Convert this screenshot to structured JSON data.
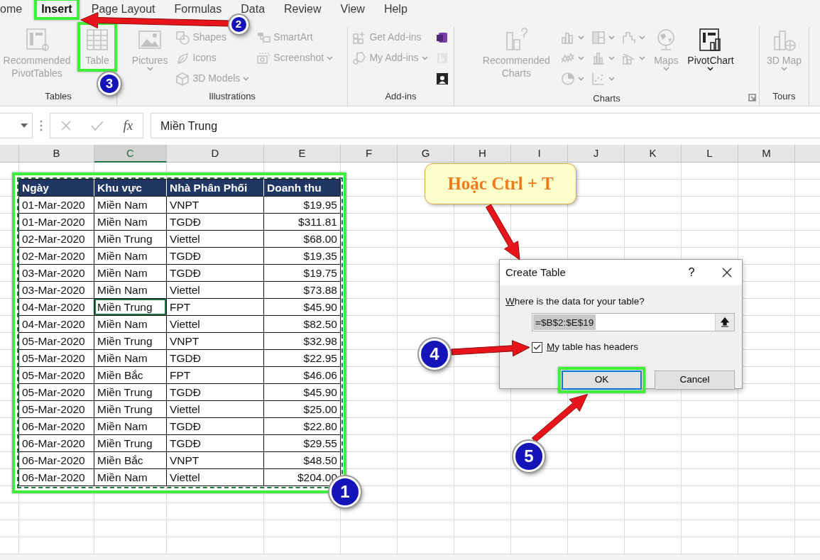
{
  "ribbon_tabs": [
    {
      "label": "ome",
      "selected": false
    },
    {
      "label": "Insert",
      "selected": true
    },
    {
      "label": "Page Layout",
      "selected": false
    },
    {
      "label": "Formulas",
      "selected": false
    },
    {
      "label": "Data",
      "selected": false
    },
    {
      "label": "Review",
      "selected": false
    },
    {
      "label": "View",
      "selected": false
    },
    {
      "label": "Help",
      "selected": false
    }
  ],
  "ribbon_groups": [
    {
      "label": "Tables",
      "items": [
        {
          "kind": "large",
          "label": "Recommended PivotTables",
          "disabled": true
        },
        {
          "kind": "large",
          "label": "Table",
          "disabled": true
        }
      ]
    },
    {
      "label": "Illustrations",
      "items": [
        {
          "kind": "large",
          "label": "Pictures",
          "disabled": true,
          "dropdown": true
        },
        {
          "kind": "small",
          "label": "Shapes",
          "disabled": true
        },
        {
          "kind": "small",
          "label": "Icons",
          "disabled": true
        },
        {
          "kind": "small",
          "label": "3D Models",
          "disabled": true,
          "dropdown": true
        },
        {
          "kind": "small",
          "label": "SmartArt",
          "disabled": true
        },
        {
          "kind": "small",
          "label": "Screenshot",
          "disabled": true,
          "dropdown": true
        }
      ]
    },
    {
      "label": "Add-ins",
      "items": [
        {
          "kind": "small",
          "label": "Get Add-ins",
          "disabled": true
        },
        {
          "kind": "small",
          "label": "My Add-ins",
          "disabled": true,
          "dropdown": true
        },
        {
          "kind": "icon",
          "disabled": false
        },
        {
          "kind": "icon",
          "disabled": true
        },
        {
          "kind": "icon",
          "disabled": false
        }
      ]
    },
    {
      "label": "Charts",
      "items": [
        {
          "kind": "large",
          "label": "Recommended Charts",
          "disabled": true
        },
        {
          "kind": "icon",
          "disabled": true,
          "dropdown": true
        },
        {
          "kind": "icon",
          "disabled": true,
          "dropdown": true
        },
        {
          "kind": "icon",
          "disabled": true,
          "dropdown": true
        },
        {
          "kind": "icon",
          "disabled": true,
          "dropdown": true
        },
        {
          "kind": "icon",
          "disabled": true,
          "dropdown": true
        },
        {
          "kind": "icon",
          "disabled": true,
          "dropdown": true
        },
        {
          "kind": "icon",
          "disabled": true,
          "dropdown": true
        },
        {
          "kind": "icon",
          "disabled": true,
          "dropdown": true
        },
        {
          "kind": "large",
          "label": "Maps",
          "disabled": true,
          "dropdown": true
        },
        {
          "kind": "large",
          "label": "PivotChart",
          "disabled": false,
          "dropdown": true
        }
      ]
    },
    {
      "label": "Tours",
      "items": [
        {
          "kind": "large",
          "label": "3D Map",
          "disabled": true,
          "dropdown": true
        }
      ]
    }
  ],
  "formula_bar": {
    "fx_label": "fx",
    "value": "Miền Trung"
  },
  "columns": [
    {
      "label": "B",
      "selected": false
    },
    {
      "label": "C",
      "selected": true
    },
    {
      "label": "D",
      "selected": false
    },
    {
      "label": "E",
      "selected": false
    },
    {
      "label": "F",
      "selected": false
    },
    {
      "label": "G",
      "selected": false
    },
    {
      "label": "H",
      "selected": false
    },
    {
      "label": "I",
      "selected": false
    },
    {
      "label": "J",
      "selected": false
    },
    {
      "label": "K",
      "selected": false
    },
    {
      "label": "L",
      "selected": false
    },
    {
      "label": "M",
      "selected": false
    }
  ],
  "data_table": {
    "headers": [
      "Ngày",
      "Khu vực",
      "Nhà Phân Phối",
      "Doanh thu"
    ],
    "rows": [
      {
        "cells": [
          {
            "text": "01-Mar-2020",
            "selected": false
          },
          {
            "text": "Miền Nam",
            "selected": false
          },
          {
            "text": "VNPT",
            "selected": false
          },
          {
            "text": "$19.95",
            "selected": false
          }
        ]
      },
      {
        "cells": [
          {
            "text": "01-Mar-2020",
            "selected": false
          },
          {
            "text": "Miền Nam",
            "selected": false
          },
          {
            "text": "TGDĐ",
            "selected": false
          },
          {
            "text": "$311.81",
            "selected": false
          }
        ]
      },
      {
        "cells": [
          {
            "text": "02-Mar-2020",
            "selected": false
          },
          {
            "text": "Miền Trung",
            "selected": false
          },
          {
            "text": "Viettel",
            "selected": false
          },
          {
            "text": "$68.00",
            "selected": false
          }
        ]
      },
      {
        "cells": [
          {
            "text": "02-Mar-2020",
            "selected": false
          },
          {
            "text": "Miền Nam",
            "selected": false
          },
          {
            "text": "TGDĐ",
            "selected": false
          },
          {
            "text": "$19.35",
            "selected": false
          }
        ]
      },
      {
        "cells": [
          {
            "text": "03-Mar-2020",
            "selected": false
          },
          {
            "text": "Miền Nam",
            "selected": false
          },
          {
            "text": "TGDĐ",
            "selected": false
          },
          {
            "text": "$19.75",
            "selected": false
          }
        ]
      },
      {
        "cells": [
          {
            "text": "03-Mar-2020",
            "selected": false
          },
          {
            "text": "Miền Nam",
            "selected": false
          },
          {
            "text": "Viettel",
            "selected": false
          },
          {
            "text": "$73.88",
            "selected": false
          }
        ]
      },
      {
        "cells": [
          {
            "text": "04-Mar-2020",
            "selected": false
          },
          {
            "text": "Miền Trung",
            "selected": true
          },
          {
            "text": "FPT",
            "selected": false
          },
          {
            "text": "$45.90",
            "selected": false
          }
        ]
      },
      {
        "cells": [
          {
            "text": "04-Mar-2020",
            "selected": false
          },
          {
            "text": "Miền Nam",
            "selected": false
          },
          {
            "text": "Viettel",
            "selected": false
          },
          {
            "text": "$82.50",
            "selected": false
          }
        ]
      },
      {
        "cells": [
          {
            "text": "05-Mar-2020",
            "selected": false
          },
          {
            "text": "Miền Trung",
            "selected": false
          },
          {
            "text": "VNPT",
            "selected": false
          },
          {
            "text": "$32.98",
            "selected": false
          }
        ]
      },
      {
        "cells": [
          {
            "text": "05-Mar-2020",
            "selected": false
          },
          {
            "text": "Miền Nam",
            "selected": false
          },
          {
            "text": "TGDĐ",
            "selected": false
          },
          {
            "text": "$22.95",
            "selected": false
          }
        ]
      },
      {
        "cells": [
          {
            "text": "05-Mar-2020",
            "selected": false
          },
          {
            "text": "Miền Bắc",
            "selected": false
          },
          {
            "text": "FPT",
            "selected": false
          },
          {
            "text": "$46.06",
            "selected": false
          }
        ]
      },
      {
        "cells": [
          {
            "text": "05-Mar-2020",
            "selected": false
          },
          {
            "text": "Miền Trung",
            "selected": false
          },
          {
            "text": "TGDĐ",
            "selected": false
          },
          {
            "text": "$45.90",
            "selected": false
          }
        ]
      },
      {
        "cells": [
          {
            "text": "05-Mar-2020",
            "selected": false
          },
          {
            "text": "Miền Trung",
            "selected": false
          },
          {
            "text": "Viettel",
            "selected": false
          },
          {
            "text": "$25.00",
            "selected": false
          }
        ]
      },
      {
        "cells": [
          {
            "text": "06-Mar-2020",
            "selected": false
          },
          {
            "text": "Miền Nam",
            "selected": false
          },
          {
            "text": "TGDĐ",
            "selected": false
          },
          {
            "text": "$22.80",
            "selected": false
          }
        ]
      },
      {
        "cells": [
          {
            "text": "06-Mar-2020",
            "selected": false
          },
          {
            "text": "Miền Trung",
            "selected": false
          },
          {
            "text": "TGDĐ",
            "selected": false
          },
          {
            "text": "$29.55",
            "selected": false
          }
        ]
      },
      {
        "cells": [
          {
            "text": "06-Mar-2020",
            "selected": false
          },
          {
            "text": "Miền Bắc",
            "selected": false
          },
          {
            "text": "VNPT",
            "selected": false
          },
          {
            "text": "$48.50",
            "selected": false
          }
        ]
      },
      {
        "cells": [
          {
            "text": "06-Mar-2020",
            "selected": false
          },
          {
            "text": "Miền Nam",
            "selected": false
          },
          {
            "text": "Viettel",
            "selected": false
          },
          {
            "text": "$204.00",
            "selected": false
          }
        ]
      }
    ]
  },
  "dialog": {
    "title": "Create Table",
    "help": "?",
    "prompt": {
      "access_key": "W",
      "rest": "here is the data for your table?"
    },
    "range": {
      "value": "=$B$2:$E$19",
      "selected": true
    },
    "checkbox": {
      "access_key": "M",
      "rest": "y table has headers",
      "checked": true
    },
    "buttons": [
      {
        "label": "OK",
        "default": true
      },
      {
        "label": "Cancel",
        "default": false
      }
    ]
  },
  "callout": {
    "text": "Hoặc Ctrl + T"
  },
  "step_badges": [
    "1",
    "2",
    "3",
    "4",
    "5"
  ]
}
